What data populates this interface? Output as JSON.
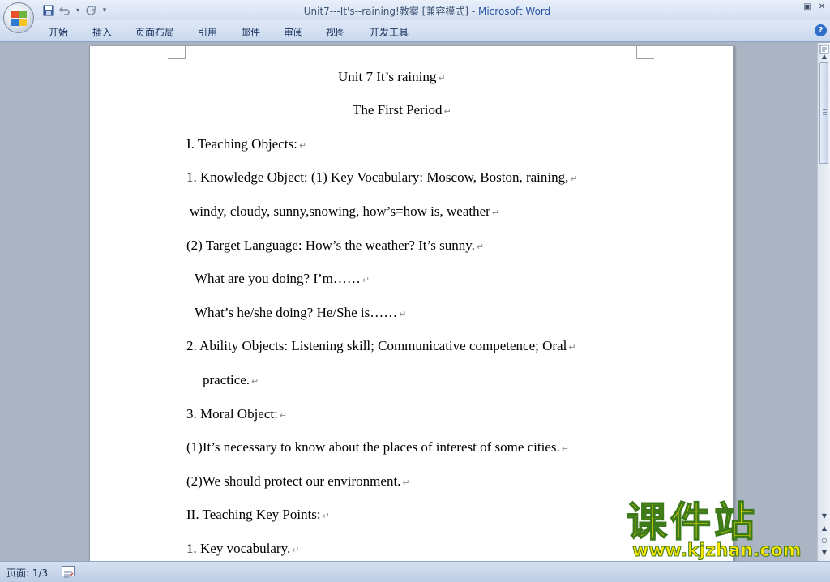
{
  "window": {
    "title": "Unit7---It's--raining!教案 [兼容模式] - ",
    "app_name": "Microsoft Word",
    "controls": {
      "minimize": "─",
      "restore": "▣",
      "close": "✕"
    }
  },
  "quick_access": {
    "save_icon": "save-icon",
    "undo_icon": "undo-icon",
    "redo_icon": "redo-icon",
    "customize_icon": "customize-icon"
  },
  "ribbon": {
    "tabs": [
      "开始",
      "插入",
      "页面布局",
      "引用",
      "邮件",
      "审阅",
      "视图",
      "开发工具"
    ],
    "help_label": "?"
  },
  "document": {
    "paragraphs": [
      "Unit 7 It’s raining",
      "The First Period",
      "I. Teaching Objects:",
      "1. Knowledge Object: (1) Key Vocabulary:  Moscow, Boston, raining,",
      "windy, cloudy, sunny,snowing, how’s=how is, weather",
      "(2) Target Language: How’s the weather? It’s sunny.",
      "What are you doing?  I’m……",
      "What’s he/she doing?  He/She is……",
      "2. Ability Objects: Listening skill; Communicative competence; Oral",
      "practice.",
      "3. Moral Object:",
      "(1)It’s necessary to know about the places of interest of some cities.",
      "(2)We should protect our environment.",
      "II. Teaching Key Points:",
      "1. Key vocabulary."
    ],
    "paragraph_mark": "↵"
  },
  "watermark": {
    "title": "课件站",
    "url": "www.kjzhan.com"
  },
  "status_bar": {
    "page_label": "页面: 1/3"
  },
  "colors": {
    "accent": "#2a56a8",
    "watermark_fill": "#ffe600",
    "watermark_stroke": "#3c7a1a"
  }
}
